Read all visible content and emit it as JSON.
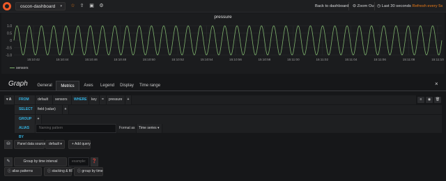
{
  "navbar": {
    "dashboard_title": "oscon-dashboard",
    "back_label": "Back to dashboard",
    "zoom_label": "Zoom Out",
    "time_range_label": "Last 30 seconds",
    "refresh_label": "Refresh every 5s"
  },
  "panel": {
    "title": "pressure",
    "y_ticks": [
      "1.0",
      "0.5",
      "0",
      "-0.5",
      "-1.0"
    ],
    "x_ticks": [
      "15:10:42",
      "15:10:44",
      "15:10:46",
      "15:10:48",
      "15:10:50",
      "15:10:52",
      "15:10:54",
      "15:10:56",
      "15:10:58",
      "15:11:00",
      "15:11:02",
      "15:11:04",
      "15:11:06",
      "15:11:08",
      "15:11:10"
    ],
    "legend_series": "sensors",
    "series_color": "#7eb26d"
  },
  "chart_data": {
    "type": "line",
    "title": "pressure",
    "xlabel": "",
    "ylabel": "",
    "ylim": [
      -1.0,
      1.0
    ],
    "x_range": [
      "15:10:41",
      "15:11:11"
    ],
    "series": [
      {
        "name": "sensors",
        "shape": "sine",
        "amplitude": 1.0,
        "cycles": 35
      }
    ],
    "grid": true,
    "legend": "bottom-left"
  },
  "editor": {
    "title": "Graph",
    "close_symbol": "×",
    "tabs": [
      "General",
      "Metrics",
      "Axes",
      "Legend",
      "Display",
      "Time range"
    ],
    "active_tab": "Metrics",
    "query": {
      "ref": "A",
      "from_label": "FROM",
      "from_policy": "default",
      "from_measurement": "sensors",
      "where_label": "WHERE",
      "where_key": "key",
      "where_op": "=",
      "where_value": "pressure",
      "select_label": "SELECT",
      "select_field": "field (value)",
      "groupby_label": "GROUP BY",
      "alias_label": "ALIAS BY",
      "alias_placeholder": "Naming pattern",
      "format_label": "Format as",
      "format_value": "Time series"
    },
    "datasource": {
      "label": "Panel data source",
      "value": "default",
      "add_query": "Add query"
    },
    "options": {
      "group_by_time_label": "Group by time interval",
      "group_by_time_placeholder": "example: >10s",
      "alias_patterns": "alias patterns",
      "stacking_fill": "stacking & fill",
      "group_by_time": "group by time"
    }
  }
}
